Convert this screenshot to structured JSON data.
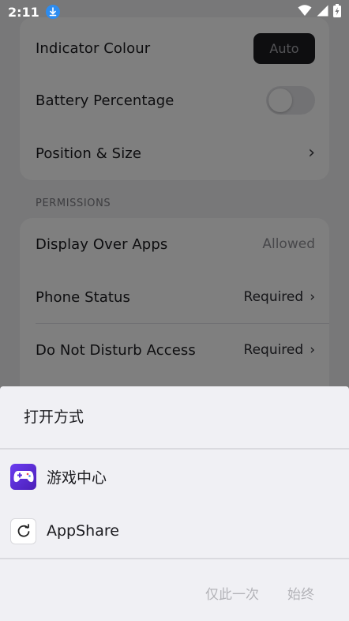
{
  "status_bar": {
    "time": "2:11",
    "icons": [
      "download-icon",
      "wifi-icon",
      "signal-icon",
      "battery-charging-icon"
    ]
  },
  "settings": {
    "rows_group1": [
      {
        "label": "Indicator Colour",
        "control": "pill",
        "value": "Auto"
      },
      {
        "label": "Battery Percentage",
        "control": "toggle",
        "toggle_on": false
      },
      {
        "label": "Position & Size",
        "control": "chevron",
        "chevron": "›"
      }
    ],
    "permissions_header": "PERMISSIONS",
    "rows_group2": [
      {
        "label": "Display Over Apps",
        "value": "Allowed"
      },
      {
        "label": "Phone Status",
        "value": "Required",
        "chevron": "›"
      },
      {
        "label": "Do Not Disturb Access",
        "value": "Required",
        "chevron": "›"
      }
    ]
  },
  "sheet": {
    "title": "打开方式",
    "apps": [
      {
        "label": "游戏中心",
        "icon": "gamepad-icon",
        "icon_color": "#5a2ee0"
      },
      {
        "label": "AppShare",
        "icon": "share-refresh-icon"
      }
    ],
    "actions": {
      "once": "仅此一次",
      "always": "始终"
    }
  },
  "colors": {
    "accent_download": "#2d8cf0",
    "scrim": "rgba(0,0,0,0.5)",
    "disabled_text": "#b3b3b8"
  }
}
